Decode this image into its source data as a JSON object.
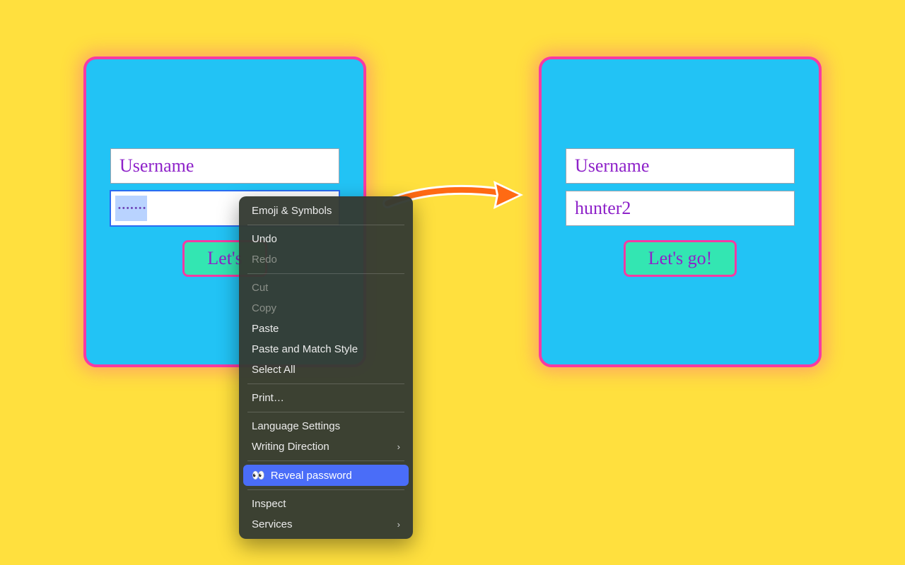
{
  "left_panel": {
    "username_placeholder": "Username",
    "password_masked": "•••••••",
    "submit_label": "Let's"
  },
  "right_panel": {
    "username_placeholder": "Username",
    "password_value": "hunter2",
    "submit_label": "Let's go!"
  },
  "context_menu": {
    "items": [
      {
        "label": "Emoji & Symbols",
        "enabled": true
      },
      {
        "sep": true
      },
      {
        "label": "Undo",
        "enabled": true
      },
      {
        "label": "Redo",
        "enabled": false
      },
      {
        "sep": true
      },
      {
        "label": "Cut",
        "enabled": false
      },
      {
        "label": "Copy",
        "enabled": false
      },
      {
        "label": "Paste",
        "enabled": true
      },
      {
        "label": "Paste and Match Style",
        "enabled": true
      },
      {
        "label": "Select All",
        "enabled": true
      },
      {
        "sep": true
      },
      {
        "label": "Print…",
        "enabled": true
      },
      {
        "sep": true
      },
      {
        "label": "Language Settings",
        "enabled": true
      },
      {
        "label": "Writing Direction",
        "enabled": true,
        "submenu": true
      },
      {
        "sep": true
      },
      {
        "label": "Reveal password",
        "enabled": true,
        "highlight": true,
        "icon": "👀"
      },
      {
        "sep": true
      },
      {
        "label": "Inspect",
        "enabled": true
      },
      {
        "label": "Services",
        "enabled": true,
        "submenu": true
      }
    ]
  },
  "colors": {
    "bg": "#ffe03e",
    "panel": "#22c3f5",
    "border": "#f73aa3",
    "button": "#33e6b2",
    "text": "#8e22c9",
    "highlight": "#4a6df8",
    "arrow": "#ff6a13"
  }
}
